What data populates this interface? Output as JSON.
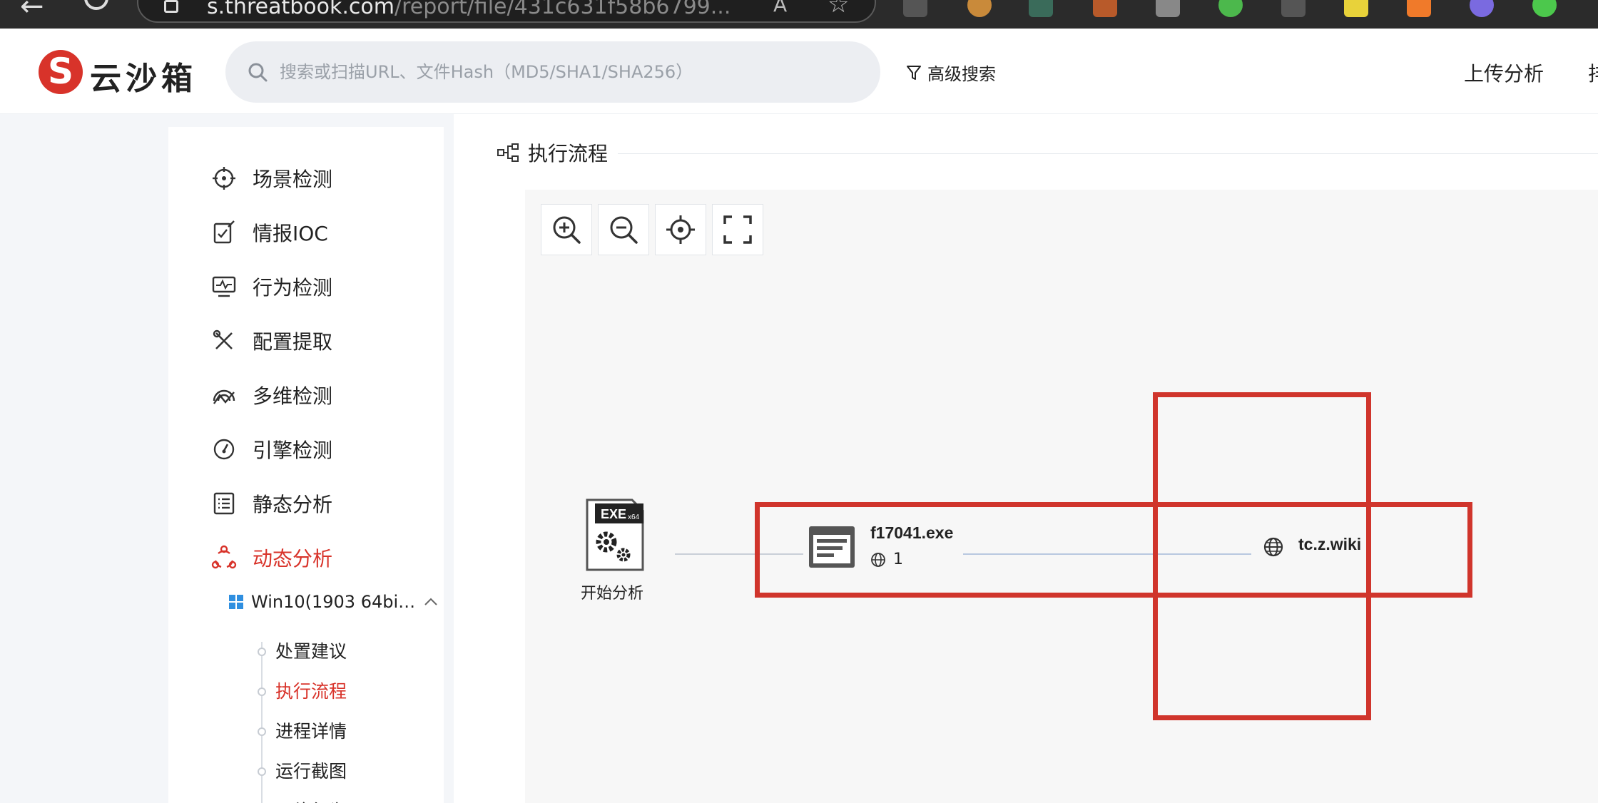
{
  "browser": {
    "url_host": "s.threatbook.com",
    "url_path": "/report/file/431c631f58b6799...",
    "read_aloud": "A"
  },
  "header": {
    "logo_mark": "S",
    "logo_text": "云沙箱",
    "search_placeholder": "搜索或扫描URL、文件Hash（MD5/SHA1/SHA256）",
    "advanced_search": "高级搜索",
    "upload": "上传分析",
    "cut_off_item": "排"
  },
  "sidebar": {
    "items": [
      {
        "label": "场景检测",
        "icon": "target-icon"
      },
      {
        "label": "情报IOC",
        "icon": "checklist-edit-icon"
      },
      {
        "label": "行为检测",
        "icon": "monitor-pulse-icon"
      },
      {
        "label": "配置提取",
        "icon": "tools-icon"
      },
      {
        "label": "多维检测",
        "icon": "radar-icon"
      },
      {
        "label": "引擎检测",
        "icon": "gauge-icon"
      },
      {
        "label": "静态分析",
        "icon": "list-doc-icon"
      },
      {
        "label": "动态分析",
        "icon": "nodes-icon"
      }
    ],
    "active_item": "动态分析",
    "os_env": "Win10(1903 64bi…",
    "sub_items": [
      "处置建议",
      "执行流程",
      "进程详情",
      "运行截图",
      "网络行为"
    ],
    "active_sub_item": "执行流程"
  },
  "main": {
    "section_title": "执行流程",
    "tools": [
      "zoom-in-icon",
      "zoom-out-icon",
      "locate-icon",
      "fullscreen-icon"
    ],
    "graph": {
      "start_badge": "EXE",
      "start_badge_sub": "x64",
      "start_label": "开始分析",
      "process_name": "f17041.exe",
      "process_network_count": "1",
      "domain": "tc.z.wiki"
    }
  },
  "colors": {
    "accent": "#d8332a",
    "highlight": "#d0352c"
  }
}
